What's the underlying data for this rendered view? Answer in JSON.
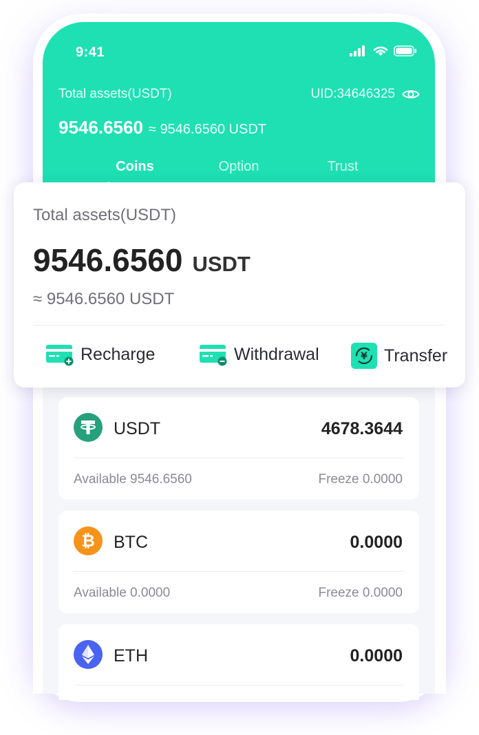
{
  "status_bar": {
    "time": "9:41"
  },
  "header": {
    "total_label": "Total assets(USDT)",
    "uid": "UID:34646325",
    "amount": "9546.6560",
    "approx": "≈ 9546.6560 USDT",
    "tabs": [
      {
        "label": "Coins",
        "active": true
      },
      {
        "label": "Option",
        "active": false
      },
      {
        "label": "Trust",
        "active": false
      }
    ]
  },
  "card": {
    "label": "Total assets(USDT)",
    "amount": "9546.6560",
    "unit": "USDT",
    "approx": "≈ 9546.6560 USDT",
    "actions": [
      {
        "label": "Recharge",
        "icon": "recharge-icon"
      },
      {
        "label": "Withdrawal",
        "icon": "withdrawal-icon"
      },
      {
        "label": "Transfer",
        "icon": "transfer-icon"
      }
    ]
  },
  "coins": [
    {
      "name": "USDT",
      "value": "4678.3644",
      "available": "Available 9546.6560",
      "freeze": "Freeze 0.0000",
      "icon": "usdt-icon",
      "color": "#26a17b"
    },
    {
      "name": "BTC",
      "value": "0.0000",
      "available": "Available 0.0000",
      "freeze": "Freeze 0.0000",
      "icon": "btc-icon",
      "color": "#f7931a"
    },
    {
      "name": "ETH",
      "value": "0.0000",
      "available": "",
      "freeze": "",
      "icon": "eth-icon",
      "color": "#4a63f0"
    }
  ],
  "colors": {
    "brand": "#1ee0b3",
    "text_primary": "#222222",
    "text_secondary": "#6f6f78"
  }
}
